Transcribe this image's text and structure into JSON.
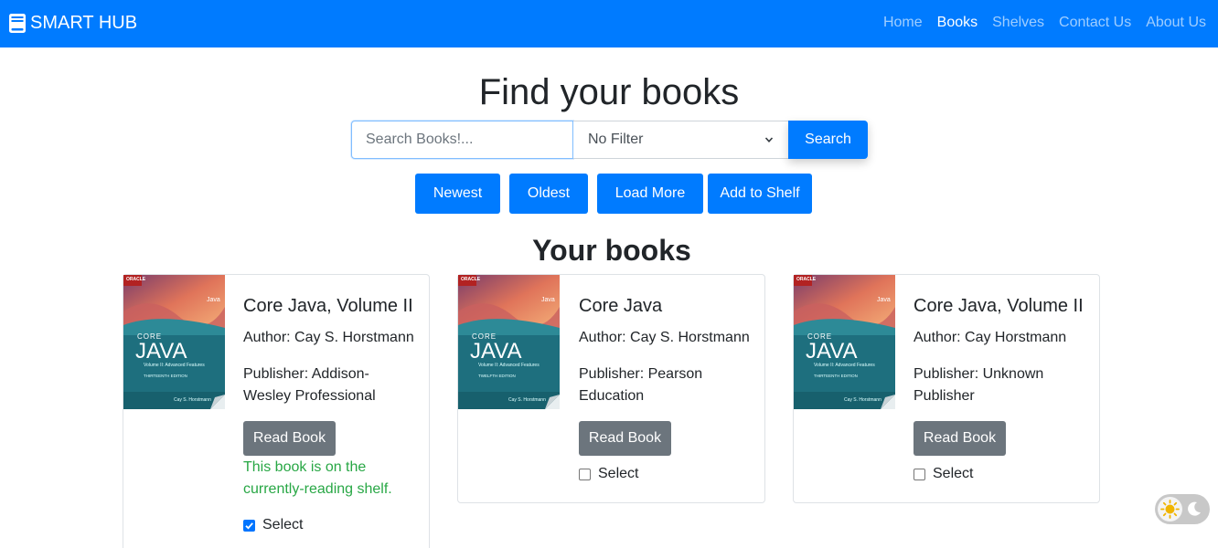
{
  "navbar": {
    "brand": "SMART HUB",
    "brand_icon": "book-icon",
    "links": [
      {
        "label": "Home",
        "active": false
      },
      {
        "label": "Books",
        "active": true
      },
      {
        "label": "Shelves",
        "active": false
      },
      {
        "label": "Contact Us",
        "active": false
      },
      {
        "label": "About Us",
        "active": false
      }
    ],
    "color": "#007bff"
  },
  "search": {
    "title": "Find your books",
    "placeholder": "Search Books!...",
    "value": "",
    "filter_selected": "No Filter",
    "button_label": "Search"
  },
  "actions": {
    "newest": "Newest",
    "oldest": "Oldest",
    "load_more": "Load More",
    "add_to_shelf": "Add to Shelf"
  },
  "section": {
    "title": "Your books"
  },
  "books": [
    {
      "title": "Core Java, Volume II",
      "author": "Author: Cay S. Horstmann",
      "publisher": "Publisher: Addison-Wesley Professional",
      "read_label": "Read Book",
      "shelf_note": "This book is on the currently-reading shelf.",
      "select_label": "Select",
      "selected": true,
      "cover": {
        "brand": "ORACLE",
        "series": "CORE",
        "name": "JAVA",
        "subtitle": "Volume II: Advanced Features",
        "edition": "THIRTEENTH EDITION",
        "author": "Cay S. Horstmann",
        "corner": "Java"
      }
    },
    {
      "title": "Core Java",
      "author": "Author: Cay S. Horstmann",
      "publisher": "Publisher: Pearson Education",
      "read_label": "Read Book",
      "shelf_note": "",
      "select_label": "Select",
      "selected": false,
      "cover": {
        "brand": "ORACLE",
        "series": "CORE",
        "name": "JAVA",
        "subtitle": "Volume II: Advanced Features",
        "edition": "TWELFTH EDITION",
        "author": "Cay S. Horstmann",
        "corner": "Java"
      }
    },
    {
      "title": "Core Java, Volume II",
      "author": "Author: Cay Horstmann",
      "publisher": "Publisher: Unknown Publisher",
      "read_label": "Read Book",
      "shelf_note": "",
      "select_label": "Select",
      "selected": false,
      "cover": {
        "brand": "ORACLE",
        "series": "CORE",
        "name": "JAVA",
        "subtitle": "Volume II: Advanced Features",
        "edition": "THIRTEENTH EDITION",
        "author": "Cay S. Horstmann",
        "corner": "Java"
      }
    }
  ],
  "theme_toggle": {
    "mode": "light",
    "icons": [
      "sun-icon",
      "moon-icon"
    ]
  }
}
